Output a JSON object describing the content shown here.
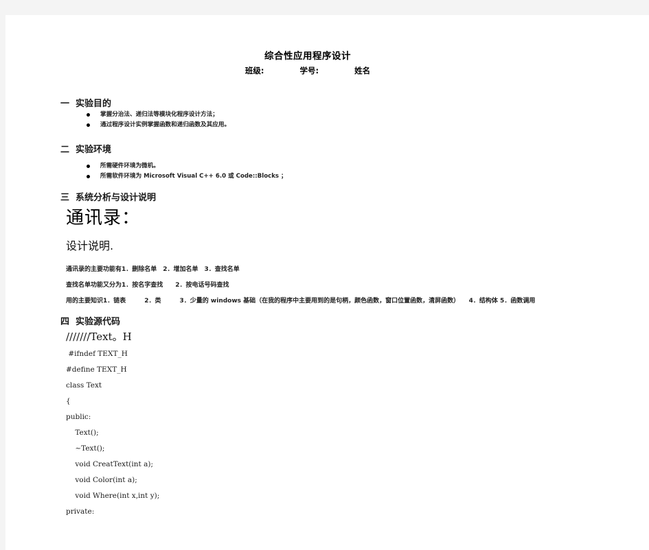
{
  "document": {
    "title": "综合性应用程序设计",
    "meta": {
      "class_label": "班级:",
      "student_id_label": "学号:",
      "name_label": "姓名"
    },
    "sections": [
      {
        "number": "一",
        "heading": "实验目的",
        "bullets": [
          "掌握分治法、递归法等模块化程序设计方法；",
          "通过程序设计实例掌握函数和递归函数及其应用。"
        ]
      },
      {
        "number": "二",
        "heading": "实验环境",
        "bullets": [
          "所需硬件环境为微机。",
          "所需软件环境为 Microsoft Visual C++ 6.0 或 Code::Blocks ；"
        ]
      },
      {
        "number": "三",
        "heading": "系统分析与设计说明"
      },
      {
        "number": "四",
        "heading": "实验源代码"
      }
    ],
    "project": {
      "name": "通讯录：",
      "design_note_heading": "设计说明.",
      "paragraphs": [
        "通讯录的主要功能有1．删除名单　2．增加名单　3．查找名单",
        "查找名单功能又分为1．按名字查找　　2．按电话号码查找",
        "用的主要知识1．链表　　　2．类　　　3．少量的 windows 基础（在我的程序中主要用到的是句柄，颜色函数，窗口位置函数，清屏函数）　　4．结构体  5．函数调用"
      ]
    },
    "source_code": {
      "file_comment": "///////Text。H",
      "lines": [
        " #ifndef TEXT_H",
        "#define TEXT_H",
        "class Text",
        "{",
        "public:",
        "    Text();",
        "    ~Text();",
        "    void CreatText(int a);",
        "    void Color(int a);",
        "    void Where(int x,int y);",
        "private:"
      ]
    }
  }
}
